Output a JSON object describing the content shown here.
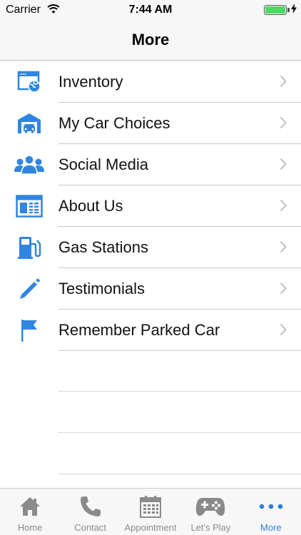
{
  "status_bar": {
    "carrier": "Carrier",
    "time": "7:44 AM"
  },
  "nav": {
    "title": "More"
  },
  "colors": {
    "accent": "#2d7fd8",
    "icon_blue": "#2f86e0",
    "tab_gray": "#8a8a8a",
    "battery": "#4cd964"
  },
  "menu": {
    "items": [
      {
        "label": "Inventory",
        "icon": "browser-globe-icon"
      },
      {
        "label": "My Car Choices",
        "icon": "garage-car-icon"
      },
      {
        "label": "Social Media",
        "icon": "people-group-icon"
      },
      {
        "label": "About Us",
        "icon": "newspaper-icon"
      },
      {
        "label": "Gas Stations",
        "icon": "gas-pump-icon"
      },
      {
        "label": "Testimonials",
        "icon": "pencil-icon"
      },
      {
        "label": "Remember Parked Car",
        "icon": "flag-icon"
      }
    ]
  },
  "tabs": [
    {
      "label": "Home",
      "icon": "house-icon"
    },
    {
      "label": "Contact",
      "icon": "phone-icon"
    },
    {
      "label": "Appointment",
      "icon": "calendar-icon"
    },
    {
      "label": "Let's Play",
      "icon": "gamepad-icon"
    },
    {
      "label": "More",
      "icon": "more-dots-icon",
      "active": true
    }
  ]
}
